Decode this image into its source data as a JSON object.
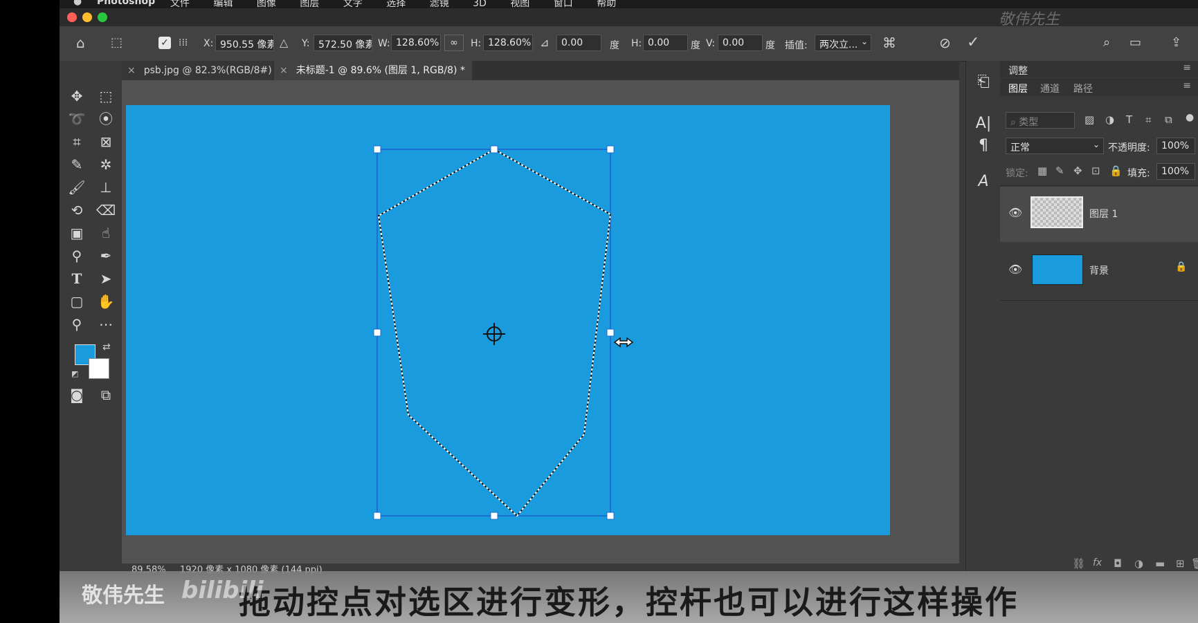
{
  "menubar": {
    "app_name": "Photoshop",
    "items": [
      "文件",
      "编辑",
      "图像",
      "图层",
      "文字",
      "选择",
      "滤镜",
      "3D",
      "视图",
      "窗口",
      "帮助"
    ]
  },
  "watermark_top": "敬伟先生",
  "options_bar": {
    "x_label": "X:",
    "x_value": "950.55 像素",
    "y_label": "Y:",
    "y_value": "572.50 像素",
    "w_label": "W:",
    "w_value": "128.60%",
    "h_label": "H:",
    "h_value": "128.60%",
    "angle_value": "0.00",
    "angle_unit": "度",
    "hskew_label": "H:",
    "hskew_value": "0.00",
    "hskew_unit": "度",
    "vskew_label": "V:",
    "vskew_value": "0.00",
    "vskew_unit": "度",
    "interp_label": "插值:",
    "interp_value": "两次立..."
  },
  "tabs": [
    {
      "label": "psb.jpg @ 82.3%(RGB/8#) *",
      "active": false
    },
    {
      "label": "未标题-1 @ 89.6% (图层 1, RGB/8) *",
      "active": true
    }
  ],
  "colors": {
    "foreground": "#1a9bdd",
    "background": "#ffffff",
    "document": "#1a9bdd",
    "selection": "#1a6fd1"
  },
  "status_bar": {
    "zoom": "89.58%",
    "doc_info": "1920 像素 x 1080 像素 (144 ppi)"
  },
  "panels": {
    "adjust_tab": "调整",
    "tabs": [
      "图层",
      "通道",
      "路径"
    ],
    "search_placeholder": "类型",
    "blend_mode": "正常",
    "opacity_label": "不透明度:",
    "opacity_value": "100%",
    "lock_label": "锁定:",
    "fill_label": "填充:",
    "fill_value": "100%",
    "layers": [
      {
        "name": "图层 1",
        "selected": true,
        "locked": false
      },
      {
        "name": "背景",
        "selected": false,
        "locked": true
      }
    ]
  },
  "subtitle": "拖动控点对选区进行变形，控杆也可以进行这样操作",
  "watermark_bottom": "敬伟先生",
  "watermark_bili": "bilibili"
}
